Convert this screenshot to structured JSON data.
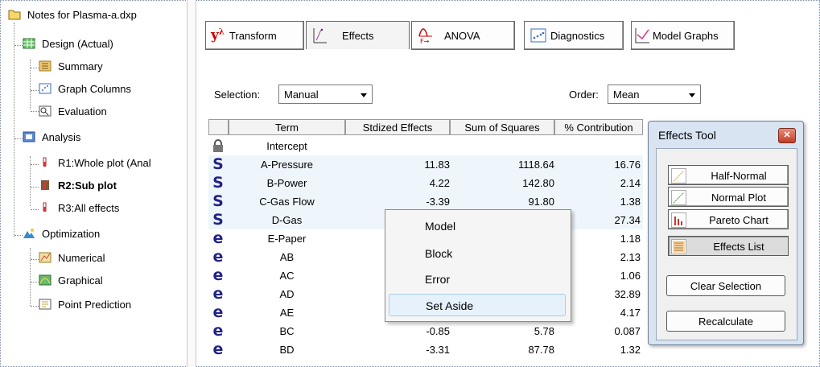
{
  "tree": {
    "root": "Notes for Plasma-a.dxp",
    "design": "Design (Actual)",
    "summary": "Summary",
    "graph_columns": "Graph Columns",
    "evaluation": "Evaluation",
    "analysis": "Analysis",
    "r1": "R1:Whole plot (Anal",
    "r2": "R2:Sub plot",
    "r3": "R3:All effects",
    "optimization": "Optimization",
    "numerical": "Numerical",
    "graphical": "Graphical",
    "point_prediction": "Point Prediction"
  },
  "toolbar": {
    "transform": "Transform",
    "effects": "Effects",
    "anova": "ANOVA",
    "diagnostics": "Diagnostics",
    "model_graphs": "Model Graphs"
  },
  "controls": {
    "selection_label": "Selection:",
    "selection_value": "Manual",
    "order_label": "Order:",
    "order_value": "Mean"
  },
  "table": {
    "headers": [
      "Term",
      "Stdized Effects",
      "Sum of Squares",
      "% Contribution"
    ],
    "rows": [
      {
        "mark": "lock",
        "term": "Intercept",
        "effect": "",
        "ss": "",
        "pct": ""
      },
      {
        "mark": "S",
        "term": "A-Pressure",
        "effect": "11.83",
        "ss": "1118.64",
        "pct": "16.76"
      },
      {
        "mark": "S",
        "term": "B-Power",
        "effect": "4.22",
        "ss": "142.80",
        "pct": "2.14"
      },
      {
        "mark": "S",
        "term": "C-Gas Flow",
        "effect": "-3.39",
        "ss": "91.80",
        "pct": "1.38"
      },
      {
        "mark": "S",
        "term": "D-Gas",
        "effect": "",
        "ss": "",
        "pct": "27.34"
      },
      {
        "mark": "e",
        "term": "E-Paper",
        "effect": "",
        "ss": "",
        "pct": "1.18"
      },
      {
        "mark": "e",
        "term": "AB",
        "effect": "",
        "ss": "",
        "pct": "2.13"
      },
      {
        "mark": "e",
        "term": "AC",
        "effect": "",
        "ss": "",
        "pct": "1.06"
      },
      {
        "mark": "e",
        "term": "AD",
        "effect": "",
        "ss": "",
        "pct": "32.89"
      },
      {
        "mark": "e",
        "term": "AE",
        "effect": "",
        "ss": "",
        "pct": "4.17"
      },
      {
        "mark": "e",
        "term": "BC",
        "effect": "-0.85",
        "ss": "5.78",
        "pct": "0.087"
      },
      {
        "mark": "e",
        "term": "BD",
        "effect": "-3.31",
        "ss": "87.78",
        "pct": "1.32"
      }
    ]
  },
  "context_menu": [
    "Model",
    "Block",
    "Error",
    "Set Aside"
  ],
  "effects_tool": {
    "title": "Effects Tool",
    "half_normal": "Half-Normal",
    "normal_plot": "Normal Plot",
    "pareto_chart": "Pareto Chart",
    "effects_list": "Effects List",
    "clear_selection": "Clear Selection",
    "recalculate": "Recalculate"
  },
  "colors": {
    "model_mark": "#222288",
    "selected_row": "#eef6fc",
    "tool_frame": "#d8e4f2",
    "close_button": "#c33d26"
  }
}
